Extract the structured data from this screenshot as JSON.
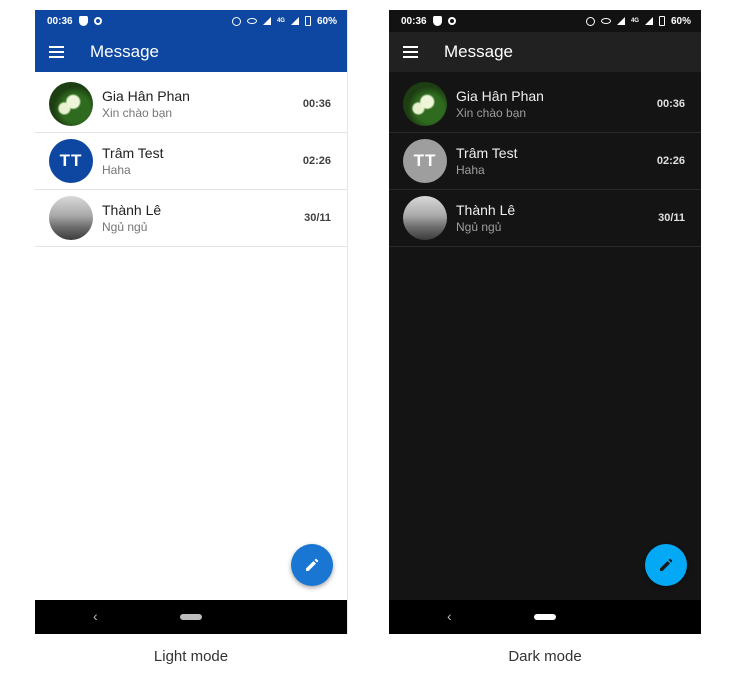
{
  "status_bar": {
    "time": "00:36",
    "battery": "60%",
    "network": "4G"
  },
  "app_title": "Message",
  "conversations": [
    {
      "name": "Gia Hân Phan",
      "preview": "Xin chào bạn",
      "time": "00:36",
      "avatar": "photo-plant"
    },
    {
      "name": "Trâm Test",
      "preview": "Haha",
      "time": "02:26",
      "avatar": "initials",
      "initials": "TT"
    },
    {
      "name": "Thành Lê",
      "preview": "Ngủ ngủ",
      "time": "30/11",
      "avatar": "photo-desk"
    }
  ],
  "captions": {
    "light": "Light mode",
    "dark": "Dark mode"
  },
  "nav": {
    "back_glyph": "‹"
  },
  "icons": {
    "menu": "menu-icon",
    "compose": "pencil-icon",
    "status": [
      "shield-icon",
      "sync-icon",
      "alarm-icon",
      "eye-icon",
      "signal-icon",
      "battery-icon"
    ]
  },
  "colors": {
    "light_primary": "#0d47a1",
    "light_fab": "#1976d2",
    "dark_background": "#141414",
    "dark_appbar": "#212121",
    "dark_fab": "#03a9f4",
    "dark_initials_avatar": "#9e9e9e"
  }
}
